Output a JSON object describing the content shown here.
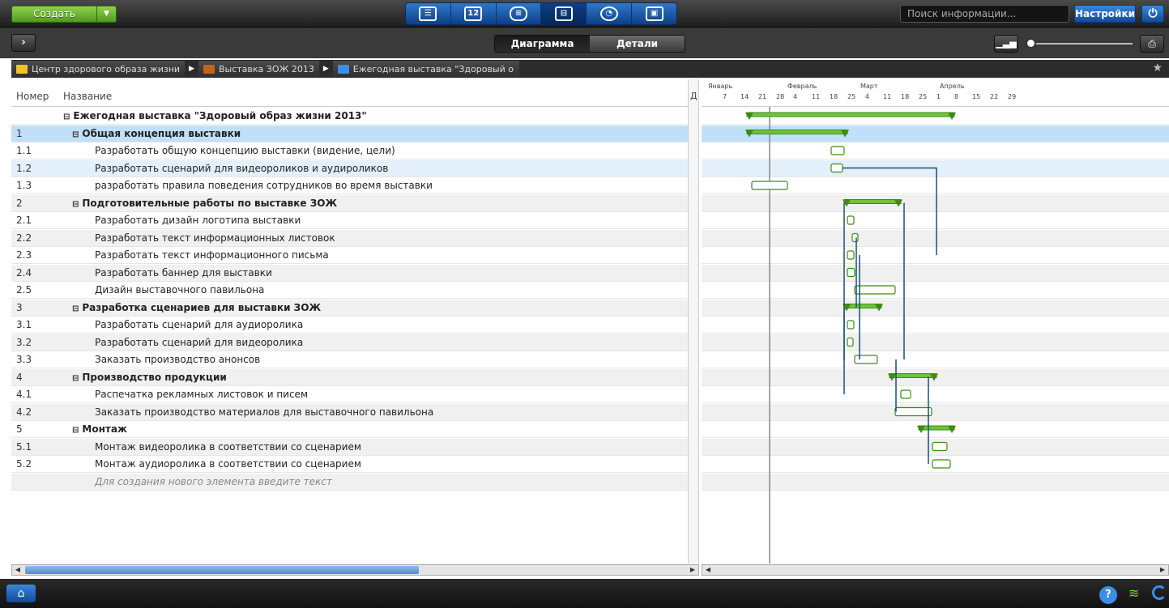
{
  "app": {
    "create_label": "Создать",
    "search_placeholder": "Поиск информации...",
    "settings_label": "Настройки"
  },
  "mode_icons": [
    "checklist-icon",
    "calendar-icon",
    "database-icon",
    "gantt-icon",
    "dashboard-icon",
    "contacts-icon"
  ],
  "calendar_day": "12",
  "tabs": [
    "Диаграмма",
    "Детали"
  ],
  "breadcrumb": [
    {
      "label": "Центр здорового образа жизни",
      "icon": "folder-icon",
      "color": "#f0c419"
    },
    {
      "label": "Выставка ЗОЖ 2013",
      "icon": "project-icon",
      "color": "#c2651a"
    },
    {
      "label": "Ежегодная выставка \"Здоровый о",
      "icon": "list-icon",
      "color": "#3d8ee6"
    }
  ],
  "table": {
    "col_number": "Номер",
    "col_name": "Название",
    "col_d": "Д",
    "rows": [
      {
        "num": "",
        "name": "Ежегодная выставка \"Здоровый образ жизни 2013\"",
        "level": 0,
        "group": true
      },
      {
        "num": "1",
        "name": "Общая концепция выставки",
        "level": 1,
        "group": true,
        "selected": true
      },
      {
        "num": "1.1",
        "name": "Разработать общую концепцию выставки (видение, цели)",
        "level": 2
      },
      {
        "num": "1.2",
        "name": "Разработать сценарий для видеороликов и аудироликов",
        "level": 2,
        "highlight": true
      },
      {
        "num": "1.3",
        "name": "разработать правила поведения сотрудников во время выставки",
        "level": 2
      },
      {
        "num": "2",
        "name": "Подготовительные работы по выставке ЗОЖ",
        "level": 1,
        "group": true
      },
      {
        "num": "2.1",
        "name": "Разработать дизайн логотипа выставки",
        "level": 2
      },
      {
        "num": "2.2",
        "name": "Разработать текст информационных листовок",
        "level": 2
      },
      {
        "num": "2.3",
        "name": "Разработать текст информационного письма",
        "level": 2
      },
      {
        "num": "2.4",
        "name": "Разработать баннер для выставки",
        "level": 2
      },
      {
        "num": "2.5",
        "name": "Дизайн выставочного павильона",
        "level": 2
      },
      {
        "num": "3",
        "name": "Разработка сценариев для выставки ЗОЖ",
        "level": 1,
        "group": true
      },
      {
        "num": "3.1",
        "name": "Разработать сценарий для аудиоролика",
        "level": 2
      },
      {
        "num": "3.2",
        "name": "Разработать сценарий для видеоролика",
        "level": 2
      },
      {
        "num": "3.3",
        "name": "Заказать производство анонсов",
        "level": 2
      },
      {
        "num": "4",
        "name": "Производство продукции",
        "level": 1,
        "group": true
      },
      {
        "num": "4.1",
        "name": "Распечатка рекламных листовок и писем",
        "level": 2
      },
      {
        "num": "4.2",
        "name": "Заказать производство материалов для выставочного павильона",
        "level": 2
      },
      {
        "num": "5",
        "name": "Монтаж",
        "level": 1,
        "group": true
      },
      {
        "num": "5.1",
        "name": "Монтаж видеоролика в соответствии со сценарием",
        "level": 2
      },
      {
        "num": "5.2",
        "name": "Монтаж аудиоролика в соответствии со сценарием",
        "level": 2
      }
    ],
    "new_row_hint": "Для создания нового элемента введите текст"
  },
  "gantt": {
    "months": [
      "Январь",
      "Февраль",
      "Март",
      "Апрель"
    ],
    "days": [
      "7",
      "14",
      "21",
      "28",
      "4",
      "11",
      "18",
      "25",
      "4",
      "11",
      "18",
      "25",
      "1",
      "8",
      "15",
      "22",
      "29"
    ]
  }
}
